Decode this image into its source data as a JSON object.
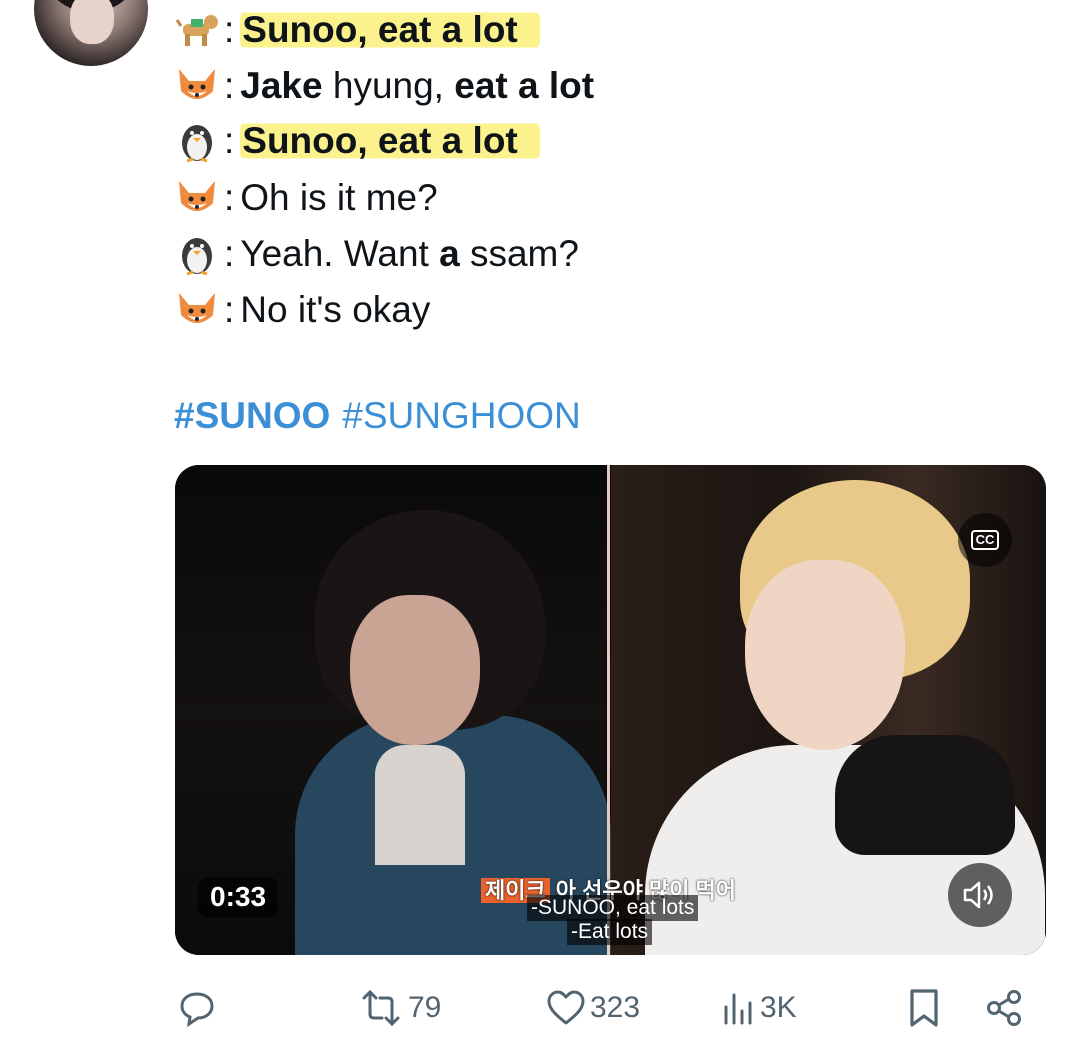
{
  "tweet": {
    "lines": [
      {
        "emoji": "dog-emoji",
        "segments": [
          {
            "text": "Sunoo, eat a lot",
            "bold": true,
            "highlight": true
          }
        ]
      },
      {
        "emoji": "fox-emoji",
        "segments": [
          {
            "text": "Jake",
            "bold": true
          },
          {
            "text": " hyung, ",
            "bold": false
          },
          {
            "text": "eat a lot",
            "bold": true
          }
        ]
      },
      {
        "emoji": "penguin-emoji",
        "segments": [
          {
            "text": "Sunoo, eat a lot",
            "bold": true,
            "highlight": true
          }
        ]
      },
      {
        "emoji": "fox-emoji",
        "segments": [
          {
            "text": "Oh is it me?",
            "bold": false
          }
        ]
      },
      {
        "emoji": "penguin-emoji",
        "segments": [
          {
            "text": "Yeah. Want ",
            "bold": false
          },
          {
            "text": "a",
            "bold": true
          },
          {
            "text": " ssam?",
            "bold": false
          }
        ]
      },
      {
        "emoji": "fox-emoji",
        "segments": [
          {
            "text": "No it's okay",
            "bold": false
          }
        ]
      }
    ],
    "colon": ":",
    "hashtags": [
      "#SUNOO",
      "#SUNGHOON"
    ],
    "hashtag_color": "#3b8fd6",
    "highlight_color": "#fbf28d"
  },
  "media": {
    "duration": "0:33",
    "cc_label": "CC",
    "subtitle_korean_speaker": "제이크",
    "subtitle_korean": "아 선우야 많이 먹어",
    "subtitle_en_1": "-SUNOO, eat lots",
    "subtitle_en_2": "-Eat lots"
  },
  "actions": {
    "reply_icon": "reply-icon",
    "retweet_count": "79",
    "like_count": "323",
    "views_count": "3K",
    "bookmark_icon": "bookmark-icon",
    "share_icon": "share-icon",
    "icon_color": "#536471"
  }
}
